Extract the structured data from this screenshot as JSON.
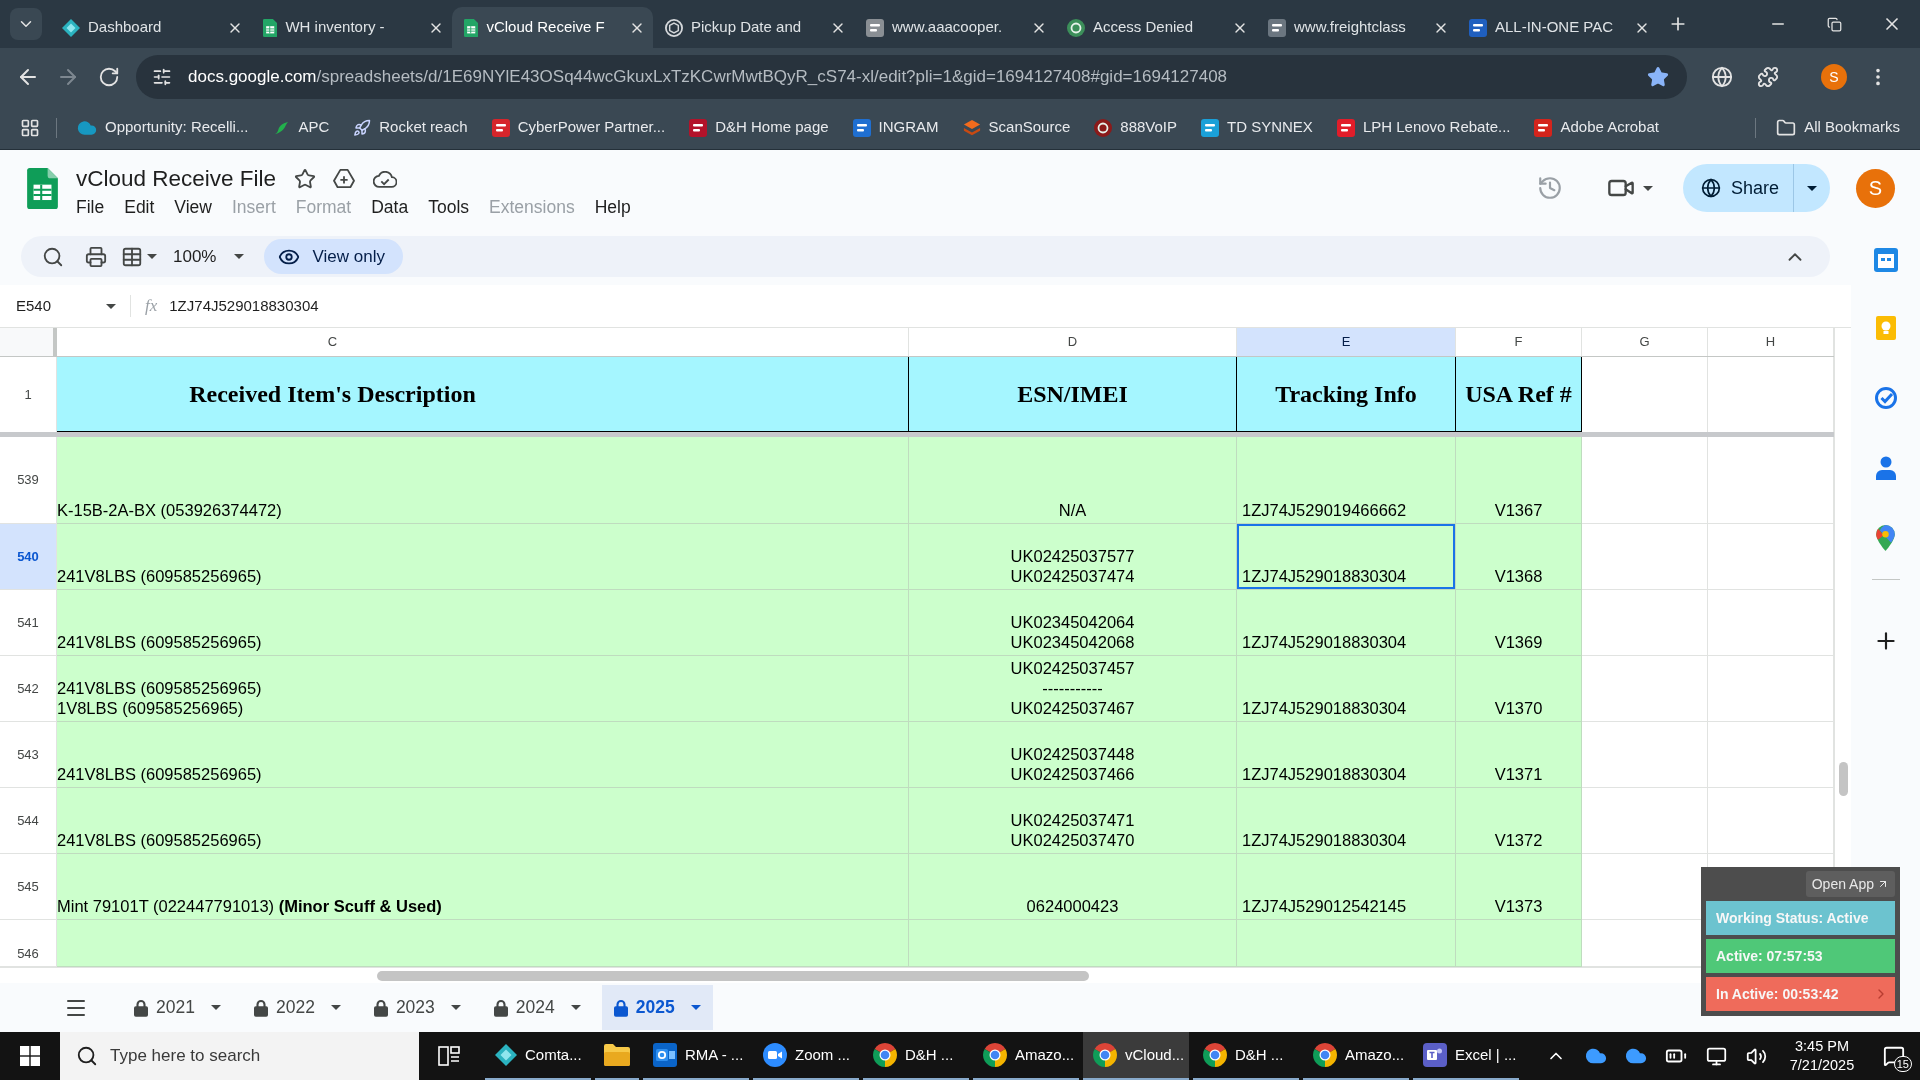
{
  "browser": {
    "tabs": [
      {
        "title": "Dashboard",
        "selected": false
      },
      {
        "title": "WH inventory -",
        "selected": false
      },
      {
        "title": "vCloud Receive F",
        "selected": true
      },
      {
        "title": "Pickup Date and",
        "selected": false
      },
      {
        "title": "www.aaacooper.",
        "selected": false
      },
      {
        "title": "Access Denied",
        "selected": false
      },
      {
        "title": "www.freightclass",
        "selected": false
      },
      {
        "title": "ALL-IN-ONE PAC",
        "selected": false
      }
    ],
    "forward_disabled": true,
    "address": {
      "host": "docs.google.com",
      "path": "/spreadsheets/d/1E69NYlE43OSq44wcGkuxLxTzKCwrMwtBQyR_cS74-xl/edit?pli=1&gid=1694127408#gid=1694127408"
    },
    "bookmarked": true,
    "profile": "S",
    "bookmarks": [
      "Opportunity: Recelli...",
      "APC",
      "Rocket reach",
      "CyberPower Partner...",
      "D&H Home page",
      "INGRAM",
      "ScanSource",
      "888VoIP",
      "TD SYNNEX",
      "LPH Lenovo Rebate...",
      "Adobe Acrobat"
    ],
    "all_bookmarks": "All Bookmarks"
  },
  "sheets": {
    "title": "vCloud Receive File",
    "menu": [
      {
        "label": "File",
        "disabled": false
      },
      {
        "label": "Edit",
        "disabled": false
      },
      {
        "label": "View",
        "disabled": false
      },
      {
        "label": "Insert",
        "disabled": true
      },
      {
        "label": "Format",
        "disabled": true
      },
      {
        "label": "Data",
        "disabled": false
      },
      {
        "label": "Tools",
        "disabled": false
      },
      {
        "label": "Extensions",
        "disabled": true
      },
      {
        "label": "Help",
        "disabled": false
      }
    ],
    "share": "Share",
    "avatar": "S",
    "zoom": "100%",
    "mode": "View only",
    "name_box": "E540",
    "fx_label": "fx",
    "formula": "1ZJ74J529018830304",
    "columns": [
      {
        "label": "C",
        "selected": false
      },
      {
        "label": "D",
        "selected": false
      },
      {
        "label": "E",
        "selected": true
      },
      {
        "label": "F",
        "selected": false
      },
      {
        "label": "G",
        "selected": false
      },
      {
        "label": "H",
        "selected": false
      }
    ],
    "header_row": {
      "number": "1",
      "cells": [
        "Received Item's Description",
        "ESN/IMEI",
        "Tracking Info",
        "USA Ref #"
      ]
    },
    "rows": [
      {
        "number": "539",
        "selected": false,
        "description": "K-15B-2A-BX (053926374472)",
        "esn_imei": "N/A",
        "tracking": "1ZJ74J529019466662",
        "usa_ref": "V1367"
      },
      {
        "number": "540",
        "selected": true,
        "description": "241V8LBS (609585256965)",
        "esn_imei": "UK02425037577\nUK02425037474",
        "tracking": "1ZJ74J529018830304",
        "usa_ref": "V1368"
      },
      {
        "number": "541",
        "selected": false,
        "description": "241V8LBS (609585256965)",
        "esn_imei": "UK02345042064\nUK02345042068",
        "tracking": "1ZJ74J529018830304",
        "usa_ref": "V1369"
      },
      {
        "number": "542",
        "selected": false,
        "description": "241V8LBS (609585256965)\n1V8LBS (609585256965)",
        "esn_imei": "UK02425037457\n-----------\nUK02425037467",
        "tracking": "1ZJ74J529018830304",
        "usa_ref": "V1370"
      },
      {
        "number": "543",
        "selected": false,
        "description": "241V8LBS (609585256965)",
        "esn_imei": "UK02425037448\nUK02425037466",
        "tracking": "1ZJ74J529018830304",
        "usa_ref": "V1371"
      },
      {
        "number": "544",
        "selected": false,
        "description": "241V8LBS (609585256965)",
        "esn_imei": "UK02425037471\nUK02425037470",
        "tracking": "1ZJ74J529018830304",
        "usa_ref": "V1372"
      },
      {
        "number": "545",
        "selected": false,
        "description": "Mint 79101T (022447791013) **(Minor Scuff & Used)**",
        "esn_imei": "0624000423",
        "tracking": "1ZJ74J529012542145",
        "usa_ref": "V1373"
      },
      {
        "number": "546",
        "selected": false
      }
    ],
    "sheet_tabs": [
      {
        "label": "2021",
        "locked": true,
        "selected": false
      },
      {
        "label": "2022",
        "locked": true,
        "selected": false
      },
      {
        "label": "2023",
        "locked": true,
        "selected": false
      },
      {
        "label": "2024",
        "locked": true,
        "selected": false
      },
      {
        "label": "2025",
        "locked": true,
        "selected": true
      }
    ]
  },
  "status_widget": {
    "open_app": "Open App",
    "lines": [
      {
        "text": "Working Status: Active",
        "color": "#6cc3cf"
      },
      {
        "text": "Active: 07:57:53",
        "color": "#4fc878"
      },
      {
        "text": "In Active: 00:53:42",
        "color": "#ef6b5b"
      }
    ]
  },
  "taskbar": {
    "search_placeholder": "Type here to search",
    "apps": [
      {
        "label": "Comta...",
        "selected": false
      },
      {
        "selected": false
      },
      {
        "label": "RMA - ...",
        "selected": false
      },
      {
        "label": "Zoom ...",
        "selected": false
      },
      {
        "label": "D&H ...",
        "selected": false
      },
      {
        "label": "Amazo...",
        "selected": false
      },
      {
        "label": "vCloud...",
        "selected": true
      },
      {
        "label": "D&H ...",
        "selected": false
      },
      {
        "label": "Amazo...",
        "selected": false
      },
      {
        "label": "Excel | ...",
        "selected": false
      }
    ],
    "time": "3:45 PM",
    "date": "7/21/2025",
    "notifications": "15"
  }
}
